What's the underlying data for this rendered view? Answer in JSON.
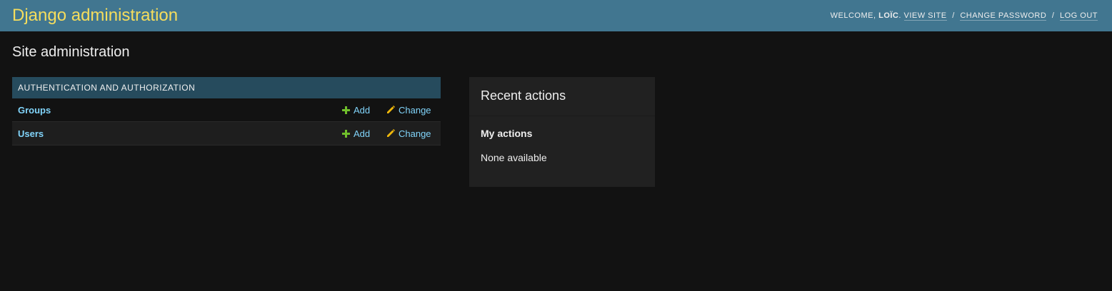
{
  "header": {
    "brand": "Django administration",
    "welcome_text": "Welcome, ",
    "username": "Loïc",
    "welcome_suffix": ".",
    "links": {
      "view_site": "View site",
      "change_password": "Change password",
      "log_out": "Log out"
    },
    "separator": "/"
  },
  "page": {
    "title": "Site administration"
  },
  "app": {
    "caption": "Authentication and Authorization",
    "models": [
      {
        "name": "Groups",
        "add_label": "Add",
        "change_label": "Change"
      },
      {
        "name": "Users",
        "add_label": "Add",
        "change_label": "Change"
      }
    ]
  },
  "recent_actions": {
    "title": "Recent actions",
    "subtitle": "My actions",
    "empty_text": "None available"
  },
  "colors": {
    "header_bg": "#417690",
    "brand": "#f5dd5d",
    "link": "#81d4fa",
    "add_icon": "#70bf2b",
    "change_icon": "#efb80b",
    "caption_bg": "#264b5d"
  }
}
